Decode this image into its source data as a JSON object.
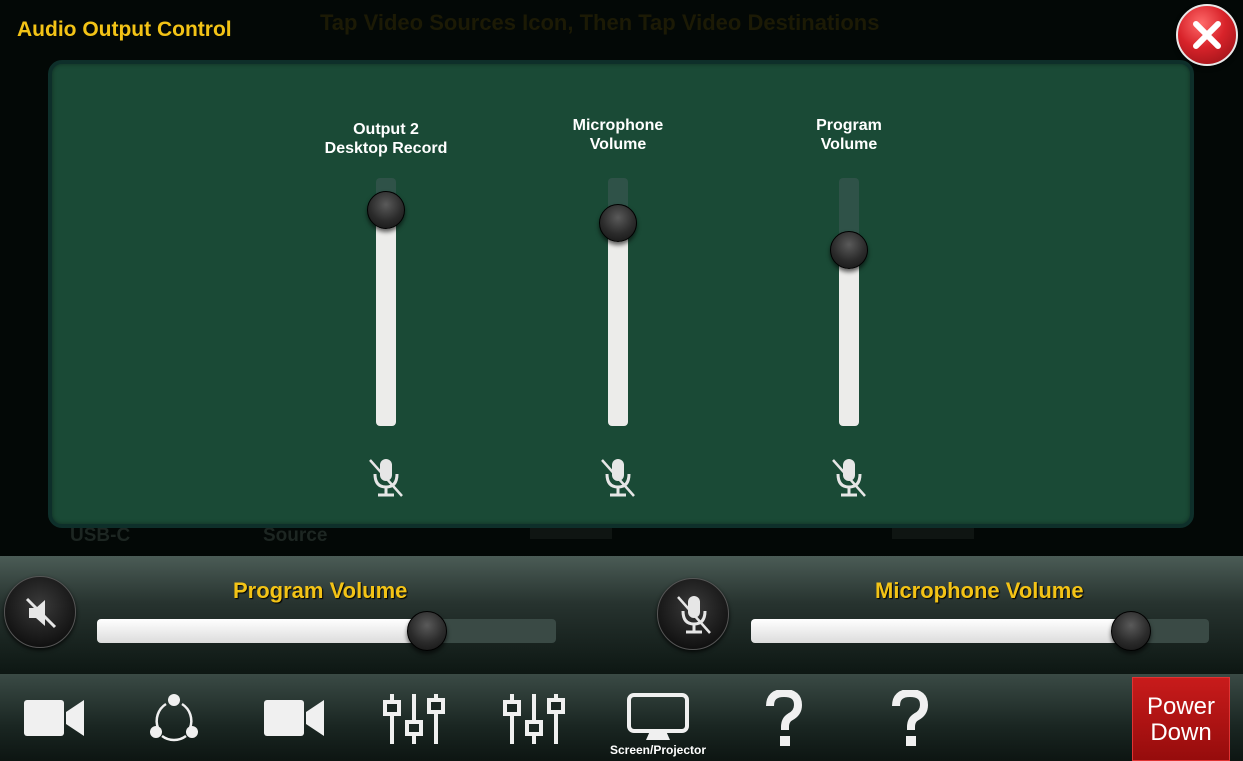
{
  "background": {
    "instruction": "Tap Video Sources Icon, Then Tap Video Destinations",
    "source_labels": [
      "USB-C",
      "Source"
    ]
  },
  "modal": {
    "title": "Audio Output Control",
    "close_icon": "close-icon",
    "channels": [
      {
        "label_line1": "Output 2",
        "label_line2": "Desktop Record",
        "level": 0.87,
        "icon": "mic-muted-icon"
      },
      {
        "label_line1": "Microphone",
        "label_line2": "Volume",
        "level": 0.82,
        "icon": "mic-muted-icon"
      },
      {
        "label_line1": "Program",
        "label_line2": "Volume",
        "level": 0.71,
        "icon": "mic-muted-icon"
      }
    ]
  },
  "volume_bar": {
    "program": {
      "title": "Program Volume",
      "level": 0.72,
      "icon": "speaker-muted-icon"
    },
    "microphone": {
      "title": "Microphone Volume",
      "level": 0.83,
      "icon": "mic-muted-icon"
    }
  },
  "toolbar": {
    "items": [
      {
        "icon": "video-camera-icon",
        "label": ""
      },
      {
        "icon": "share-icon",
        "label": ""
      },
      {
        "icon": "video-camera-icon",
        "label": ""
      },
      {
        "icon": "mixer-icon",
        "label": ""
      },
      {
        "icon": "mixer-icon",
        "label": ""
      },
      {
        "icon": "monitor-icon",
        "label": "Screen/Projector"
      },
      {
        "icon": "help-icon",
        "label": ""
      },
      {
        "icon": "help-icon",
        "label": ""
      }
    ],
    "power": {
      "line1": "Power",
      "line2": "Down"
    }
  },
  "colors": {
    "accent": "#f3c316",
    "panel": "#1a4a36",
    "power": "#b41414"
  }
}
